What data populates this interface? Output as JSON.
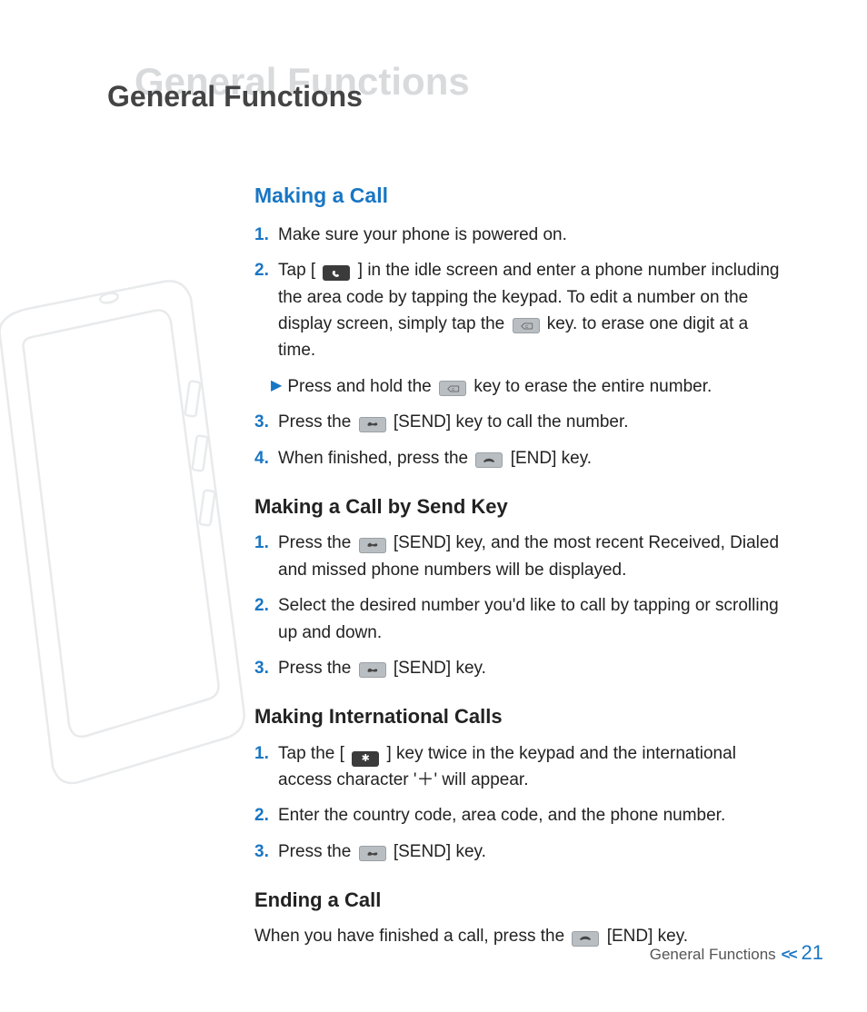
{
  "header": {
    "ghost": "General Functions",
    "title": "General Functions"
  },
  "sections": {
    "making_call": {
      "title": "Making a Call",
      "s1_num": "1.",
      "s1": "Make sure your phone is powered on.",
      "s2_num": "2.",
      "s2a": "Tap [",
      "s2b": "] in the idle screen and enter a phone number including the area code by tapping the keypad. To edit a number on the display screen, simply tap the",
      "s2c": "key. to erase one digit at a time.",
      "arrow_a": "Press and hold the",
      "arrow_b": "key to erase the entire number.",
      "s3_num": "3.",
      "s3a": "Press the",
      "s3b": "[SEND] key to call the number.",
      "s4_num": "4.",
      "s4a": "When finished, press the",
      "s4b": "[END] key."
    },
    "send_key": {
      "title": "Making a Call by Send Key",
      "s1_num": "1.",
      "s1a": "Press the",
      "s1b": "[SEND] key, and the most recent Received, Dialed and missed phone numbers will be displayed.",
      "s2_num": "2.",
      "s2": "Select the desired number you'd like to call by tapping or scrolling up and down.",
      "s3_num": "3.",
      "s3a": "Press the",
      "s3b": "[SEND] key."
    },
    "intl": {
      "title": "Making International Calls",
      "s1_num": "1.",
      "s1a": "Tap the [",
      "s1b": "] key twice in the keypad and the international access character '＋' will appear.",
      "s2_num": "2.",
      "s2": "Enter the country code, area code, and the phone number.",
      "s3_num": "3.",
      "s3a": "Press the",
      "s3b": "[SEND] key."
    },
    "ending": {
      "title": "Ending a Call",
      "text_a": "When you have finished a call, press the",
      "text_b": "[END] key."
    }
  },
  "footer": {
    "label": "General Functions",
    "chevron": "<<",
    "page": "21"
  },
  "icons": {
    "phone_key": "phone",
    "clear_key": "C",
    "send_key": "send",
    "end_key": "end",
    "star_key": "✱"
  }
}
